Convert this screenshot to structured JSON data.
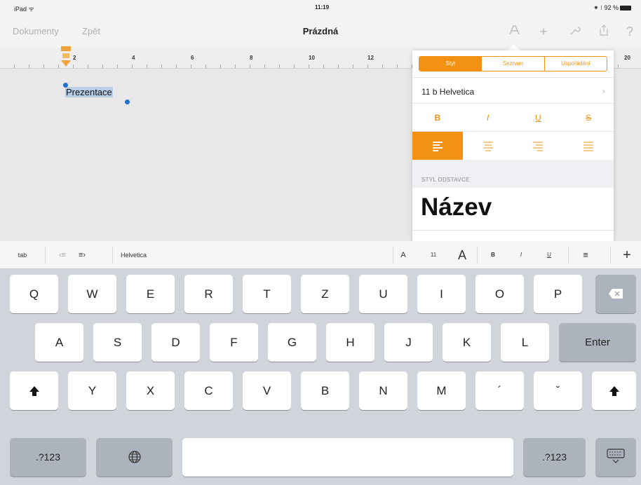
{
  "status": {
    "device": "iPad ᯤ",
    "time": "11:19",
    "right": "⁕ ⁝ 92 %"
  },
  "nav": {
    "documents": "Dokumenty",
    "back": "Zpět",
    "title": "Prázdná"
  },
  "ruler": {
    "labels": [
      "2",
      "4",
      "6",
      "8",
      "10",
      "12",
      "20"
    ]
  },
  "document": {
    "selected_text": "Prezentace"
  },
  "popover": {
    "tabs": [
      "Styl",
      "Seznam",
      "Uspořádání"
    ],
    "active_tab": "Styl",
    "font": "11 b Helvetica",
    "style_buttons": [
      "B",
      "I",
      "U",
      "S"
    ],
    "alignment": [
      "left",
      "center",
      "right",
      "justify"
    ],
    "active_alignment": "left",
    "paragraph_style_header": "STYL ODSTAVCE",
    "paragraph_style": "Název",
    "accent": "#f39212"
  },
  "shortcut_bar": {
    "tab": "tab",
    "font": "Helvetica",
    "size_small": "A",
    "size": "11",
    "size_large": "A",
    "bold": "B",
    "italic": "I",
    "underline": "U",
    "plus": "+"
  },
  "keyboard": {
    "row1": [
      "Q",
      "W",
      "E",
      "R",
      "T",
      "Z",
      "U",
      "I",
      "O",
      "P"
    ],
    "row2": [
      "A",
      "S",
      "D",
      "F",
      "G",
      "H",
      "J",
      "K",
      "L"
    ],
    "enter": "Enter",
    "row3": [
      "Y",
      "X",
      "C",
      "V",
      "B",
      "N",
      "M",
      "´",
      "ˇ"
    ],
    "numbers_left": ".?123",
    "numbers_right": ".?123"
  }
}
